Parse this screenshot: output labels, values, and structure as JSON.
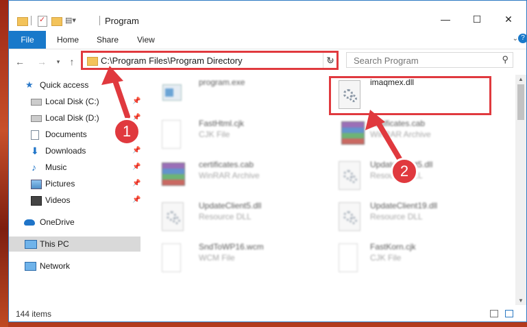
{
  "titlebar": {
    "title": "Program",
    "minimize": "—",
    "maximize": "☐",
    "close": "✕"
  },
  "ribbon": {
    "tabs": [
      "File",
      "Home",
      "Share",
      "View"
    ]
  },
  "address": {
    "path": "C:\\Program Files\\Program Directory"
  },
  "search": {
    "placeholder": "Search Program"
  },
  "sidebar": {
    "items": [
      {
        "label": "Quick access",
        "icon": "star-icon"
      },
      {
        "label": "Local Disk (C:)",
        "icon": "drive-icon"
      },
      {
        "label": "Local Disk (D:)",
        "icon": "drive-icon"
      },
      {
        "label": "Documents",
        "icon": "documents-icon"
      },
      {
        "label": "Downloads",
        "icon": "download-icon"
      },
      {
        "label": "Music",
        "icon": "music-icon"
      },
      {
        "label": "Pictures",
        "icon": "pictures-icon"
      },
      {
        "label": "Videos",
        "icon": "videos-icon"
      },
      {
        "label": "OneDrive",
        "icon": "cloud-icon"
      },
      {
        "label": "This PC",
        "icon": "computer-icon"
      },
      {
        "label": "Network",
        "icon": "network-icon"
      }
    ]
  },
  "files": [
    {
      "name": "program.exe",
      "type": ""
    },
    {
      "name": "imaqmex.dll",
      "type": ""
    },
    {
      "name": "FastHtml.cjk",
      "type": "CJK File"
    },
    {
      "name": "certificates.cab",
      "type": "WinRAR Archive"
    },
    {
      "name": "certificates.cab",
      "type": "WinRAR Archive"
    },
    {
      "name": "UpdateClient5.dll",
      "type": "Resource DLL"
    },
    {
      "name": "UpdateClient5.dll",
      "type": "Resource DLL"
    },
    {
      "name": "UpdateClient19.dll",
      "type": "Resource DLL"
    },
    {
      "name": "SndToWP16.wcm",
      "type": "WCM File"
    },
    {
      "name": "FastKorn.cjk",
      "type": "CJK File"
    }
  ],
  "status": {
    "count": "144 items"
  },
  "annotations": {
    "step1": "1",
    "step2": "2",
    "color": "#e0393e"
  }
}
